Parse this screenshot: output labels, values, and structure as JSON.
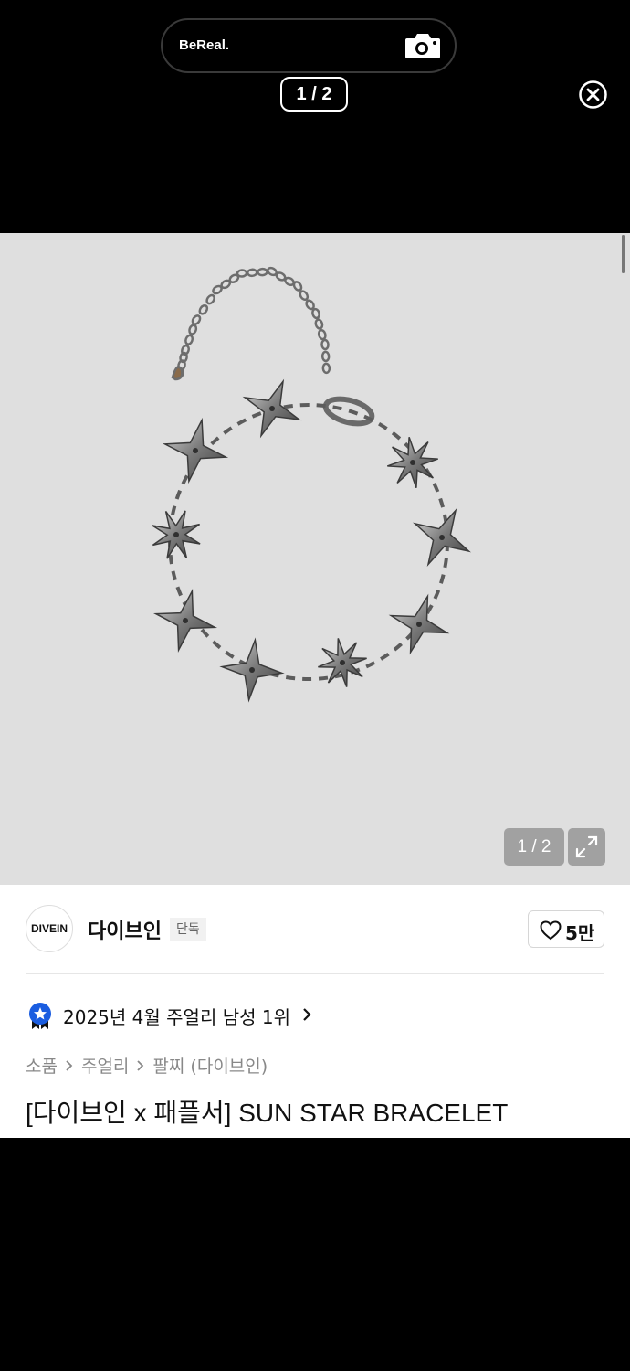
{
  "overlay": {
    "app_name": "BeReal.",
    "page_indicator": "1 / 2"
  },
  "product": {
    "image_counter": "1 / 2",
    "brand": {
      "logo_text": "DIVEIN",
      "name": "다이브인",
      "badge": "단독"
    },
    "likes": "5만",
    "ranking": "2025년 4월 주얼리 남성 1위",
    "breadcrumb": [
      "소품",
      "주얼리",
      "팔찌 (다이브인)"
    ],
    "title": "[다이브인 x 패플서] SUN STAR BRACELET"
  },
  "colors": {
    "background": "#000000",
    "image_bg": "#dfdfdf",
    "ranking_badge": "#1a5de0"
  }
}
